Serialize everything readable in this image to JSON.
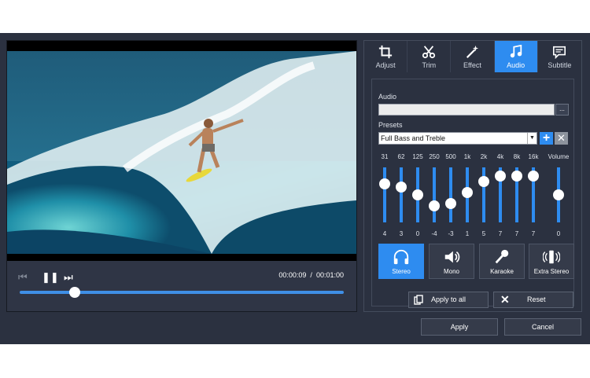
{
  "player": {
    "current_time": "00:00:09",
    "separator": "/",
    "total_time": "00:01:00",
    "progress_fraction": 0.17
  },
  "tabs": [
    {
      "label": "Adjust",
      "icon": "crop-icon"
    },
    {
      "label": "Trim",
      "icon": "scissors-icon"
    },
    {
      "label": "Effect",
      "icon": "magic-wand-icon"
    },
    {
      "label": "Audio",
      "icon": "music-note-icon",
      "active": true
    },
    {
      "label": "Subtitle",
      "icon": "subtitle-icon"
    }
  ],
  "audio": {
    "label": "Audio",
    "value": "",
    "browse_label": "..."
  },
  "presets": {
    "label": "Presets",
    "selected": "Full Bass and Treble"
  },
  "equalizer": {
    "bands": [
      {
        "freq": "31",
        "value": "4"
      },
      {
        "freq": "62",
        "value": "3"
      },
      {
        "freq": "125",
        "value": "0"
      },
      {
        "freq": "250",
        "value": "-4"
      },
      {
        "freq": "500",
        "value": "-3"
      },
      {
        "freq": "1k",
        "value": "1"
      },
      {
        "freq": "2k",
        "value": "5"
      },
      {
        "freq": "4k",
        "value": "7"
      },
      {
        "freq": "8k",
        "value": "7"
      },
      {
        "freq": "16k",
        "value": "7"
      }
    ],
    "volume": {
      "label": "Volume",
      "value": "0"
    }
  },
  "effects": [
    {
      "label": "Stereo",
      "icon": "headphones-icon",
      "active": true
    },
    {
      "label": "Mono",
      "icon": "speaker-icon"
    },
    {
      "label": "Karaoke",
      "icon": "microphone-icon"
    },
    {
      "label": "Extra Stereo",
      "icon": "surround-speakers-icon"
    }
  ],
  "actions": {
    "apply_all": "Apply to all",
    "reset": "Reset"
  },
  "footer": {
    "apply": "Apply",
    "cancel": "Cancel"
  },
  "colors": {
    "accent": "#2e8cf0",
    "background": "#2b3140"
  }
}
